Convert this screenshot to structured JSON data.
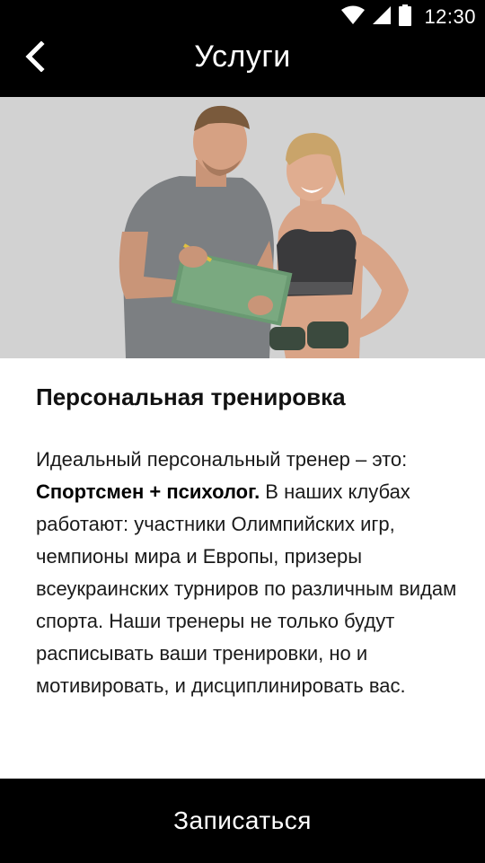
{
  "status_bar": {
    "time": "12:30",
    "icons": [
      "wifi-icon",
      "signal-icon",
      "battery-icon"
    ]
  },
  "header": {
    "title": "Услуги",
    "back_icon": "chevron-left-icon"
  },
  "hero": {
    "image": "trainer-with-client-photo"
  },
  "service": {
    "title": "Персональная тренировка",
    "desc_intro": "Идеальный персональный тренер – это:",
    "desc_bold": "Спортсмен + психолог.",
    "desc_rest": " В наших клубах работают: участники Олимпийских игр, чемпионы мира и Европы, призеры всеукраинских турниров по различным видам спорта. Наши тренеры не только будут расписывать ваши тренировки, но и мотивировать, и дисциплинировать вас."
  },
  "actions": {
    "signup_label": "Записаться"
  },
  "colors": {
    "bar": "#000000",
    "hero_bg": "#d2d2d2",
    "text": "#1a1a1a"
  }
}
